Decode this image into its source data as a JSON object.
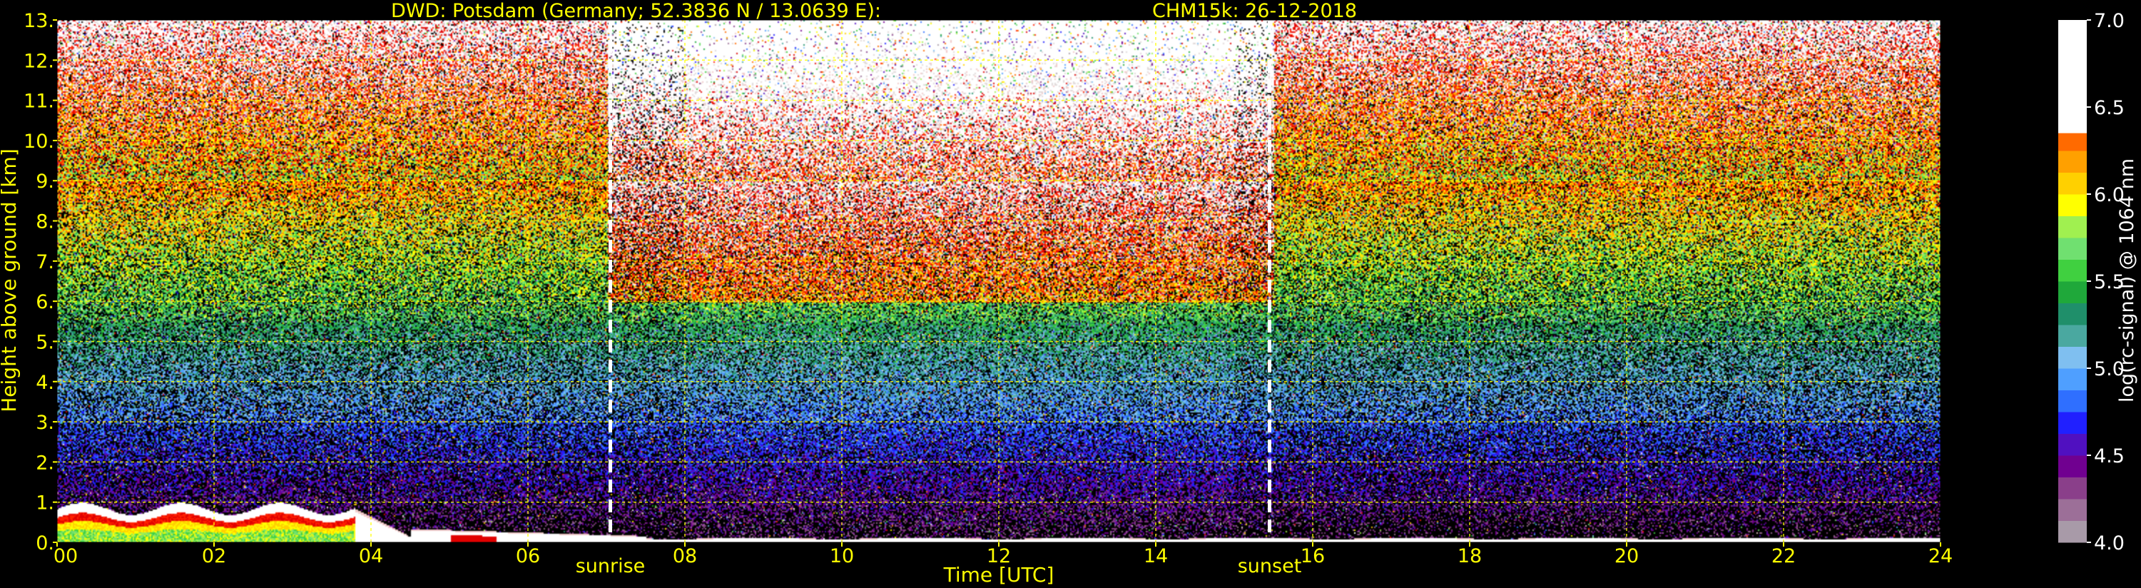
{
  "chart_data": {
    "type": "heatmap",
    "title_left": "DWD: Potsdam (Germany; 52.3836 N / 13.0639 E):",
    "title_right": "CHM15k: 26-12-2018",
    "xlabel": "Time [UTC]",
    "ylabel": "Height above ground [km]",
    "xlim": [
      0,
      24
    ],
    "ylim": [
      0,
      13
    ],
    "x_ticks": [
      "00",
      "02",
      "04",
      "06",
      "08",
      "10",
      "12",
      "14",
      "16",
      "18",
      "20",
      "22",
      "24"
    ],
    "y_ticks": [
      "0.",
      "1.",
      "2.",
      "3.",
      "4.",
      "5.",
      "6.",
      "7.",
      "8.",
      "9.",
      "10.",
      "11.",
      "12.",
      "13."
    ],
    "grid": true,
    "markers": [
      {
        "label": "sunrise",
        "time": 7.05
      },
      {
        "label": "sunset",
        "time": 15.45
      }
    ],
    "colorbar": {
      "label": "log(rc-signal) @ 1064 nm",
      "range": [
        4.0,
        7.0
      ],
      "ticks": [
        "4.0",
        "4.5",
        "5.0",
        "5.5",
        "6.0",
        "6.5",
        "7.0"
      ]
    }
  },
  "colors": {
    "text": "#ffff00",
    "grid": "#ffff00",
    "background": "#000000",
    "colormap": [
      "#a89aa8",
      "#9c6f98",
      "#8a3f8a",
      "#700090",
      "#5010c0",
      "#2020ff",
      "#2f6fff",
      "#4f9fff",
      "#7fbff0",
      "#4aa8a0",
      "#1f8f6a",
      "#1fa83a",
      "#40d040",
      "#70e070",
      "#a0f050",
      "#ffff00",
      "#ffd000",
      "#ffa000",
      "#ff6a00",
      "#ff2000",
      "#e00000",
      "#f0c8c8",
      "#e0d8d8",
      "#ffffff"
    ]
  }
}
